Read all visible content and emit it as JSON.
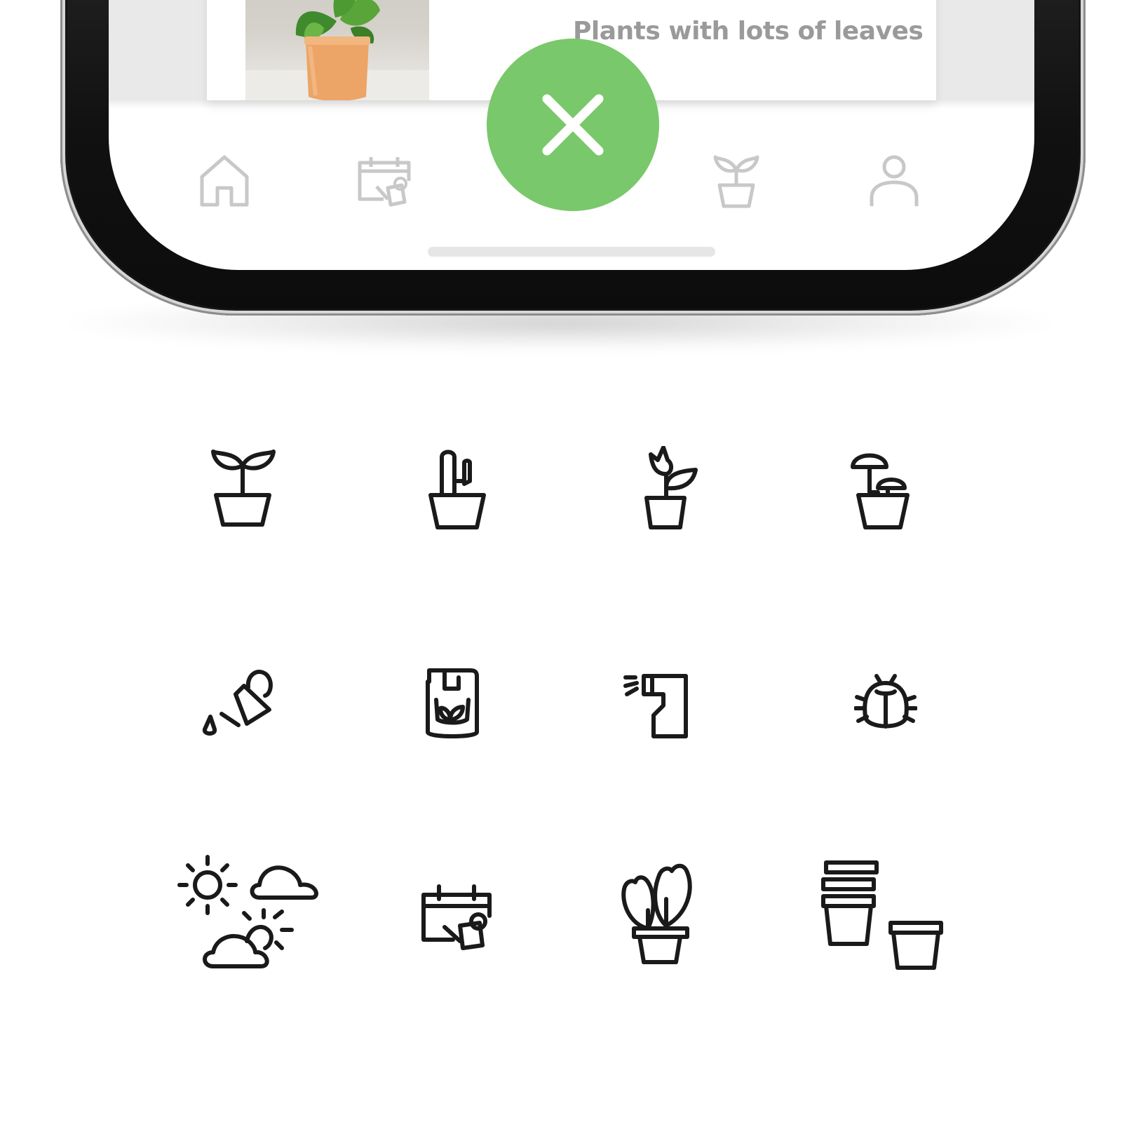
{
  "card": {
    "title": "Plants with lots of leaves"
  },
  "fab": {
    "icon": "close-icon",
    "color": "#79c86b"
  },
  "tab_bar": {
    "items": [
      {
        "icon": "home-icon"
      },
      {
        "icon": "calendar-watering-icon"
      },
      {
        "icon": "sprout-pot-icon"
      },
      {
        "icon": "profile-icon"
      }
    ],
    "icon_color": "#c8c8c8"
  },
  "icon_set": {
    "stroke_color": "#1a1a1a",
    "icons": [
      "sprout-pot-icon",
      "cactus-pot-icon",
      "flower-pot-icon",
      "mushroom-pot-icon",
      "watering-can-icon",
      "fertilizer-bag-icon",
      "spray-bottle-icon",
      "bug-icon",
      "weather-icon",
      "calendar-watering-icon",
      "tropical-plant-pot-icon",
      "stacked-pots-icon"
    ]
  }
}
